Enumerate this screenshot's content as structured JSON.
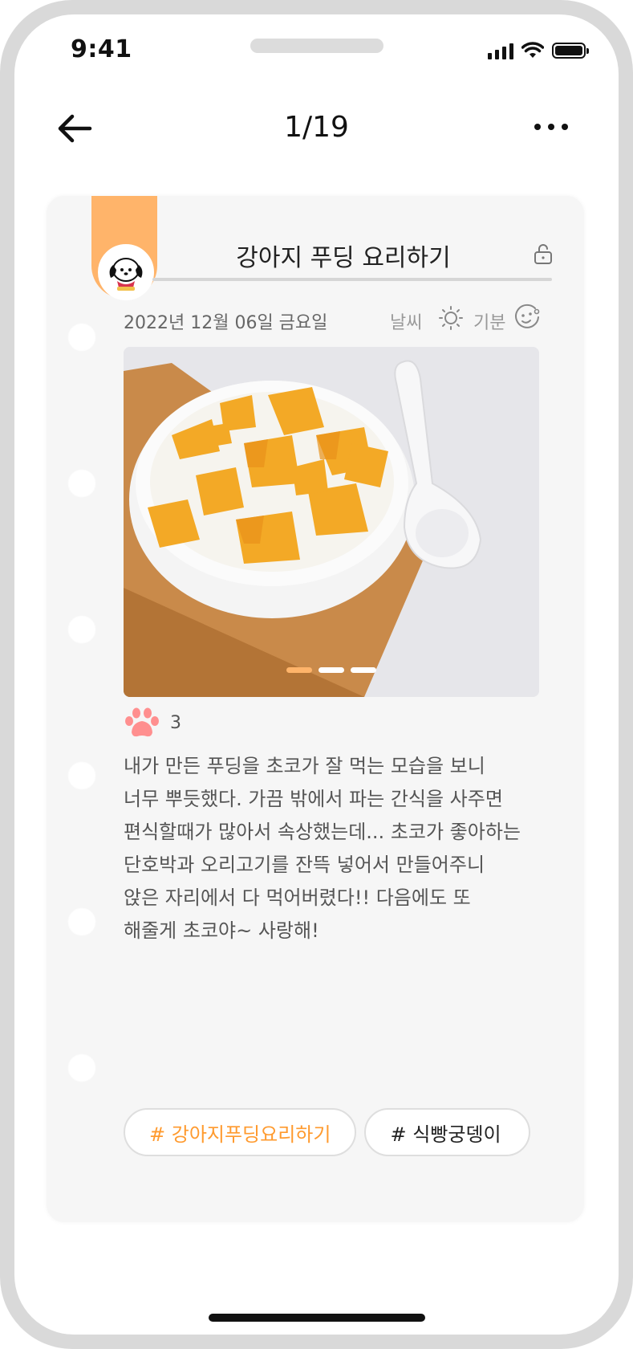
{
  "status_bar": {
    "time": "9:41"
  },
  "header": {
    "page_counter": "1/19"
  },
  "diary": {
    "title": "강아지 푸딩 요리하기",
    "date": "2022년 12월 06일 금요일",
    "weather_label": "날씨",
    "mood_label": "기분",
    "like_count": "3",
    "body": "내가 만든 푸딩을 초코가 잘 먹는 모습을 보니 너무 뿌듯했다. 가끔 밖에서 파는 간식을 사주면 편식할때가 많아서 속상했는데... 초코가 좋아하는 단호박과 오리고기를 잔뜩 넣어서 만들어주니 앉은 자리에서 다 먹어버렸다!! 다음에도 또 해줄게 초코야~ 사랑해!",
    "photo_count": 3,
    "active_photo_index": 0,
    "tags": [
      "# 강아지푸딩요리하기",
      "# 식빵궁뎅이"
    ]
  },
  "colors": {
    "accent": "#ffb46a",
    "tag_accent": "#ff9a2e",
    "paw": "#ff8f8f"
  },
  "icons": [
    "back-arrow-icon",
    "more-icon",
    "lock-icon",
    "sun-icon",
    "mood-face-icon",
    "paw-icon"
  ]
}
